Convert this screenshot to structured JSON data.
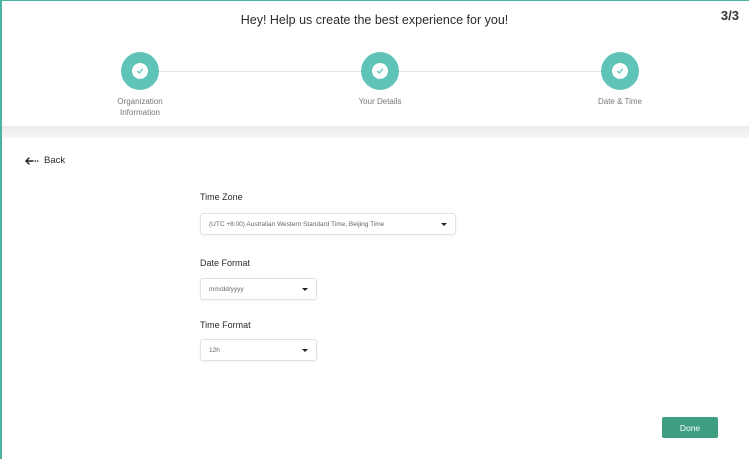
{
  "header": {
    "title": "Hey! Help us create the best experience for you!",
    "step_count": "3/3"
  },
  "steps": [
    {
      "label": "Organization\nInformation",
      "icon": "check-icon",
      "status": "complete"
    },
    {
      "label": "Your Details",
      "icon": "check-icon",
      "status": "complete"
    },
    {
      "label": "Date & Time",
      "icon": "check-icon",
      "status": "complete"
    }
  ],
  "nav": {
    "back_label": "Back",
    "back_icon": "arrow-left-icon"
  },
  "form": {
    "time_zone": {
      "label": "Time Zone",
      "value": "(UTC +8:00) Australian Western Standard Time, Beijing Time"
    },
    "date_format": {
      "label": "Date Format",
      "value": "mm/dd/yyyy"
    },
    "time_format": {
      "label": "Time Format",
      "value": "12h"
    }
  },
  "actions": {
    "done_label": "Done"
  },
  "colors": {
    "accent": "#5fc4b7",
    "frame": "#4fb3a4",
    "done_button": "#3d9e82"
  }
}
